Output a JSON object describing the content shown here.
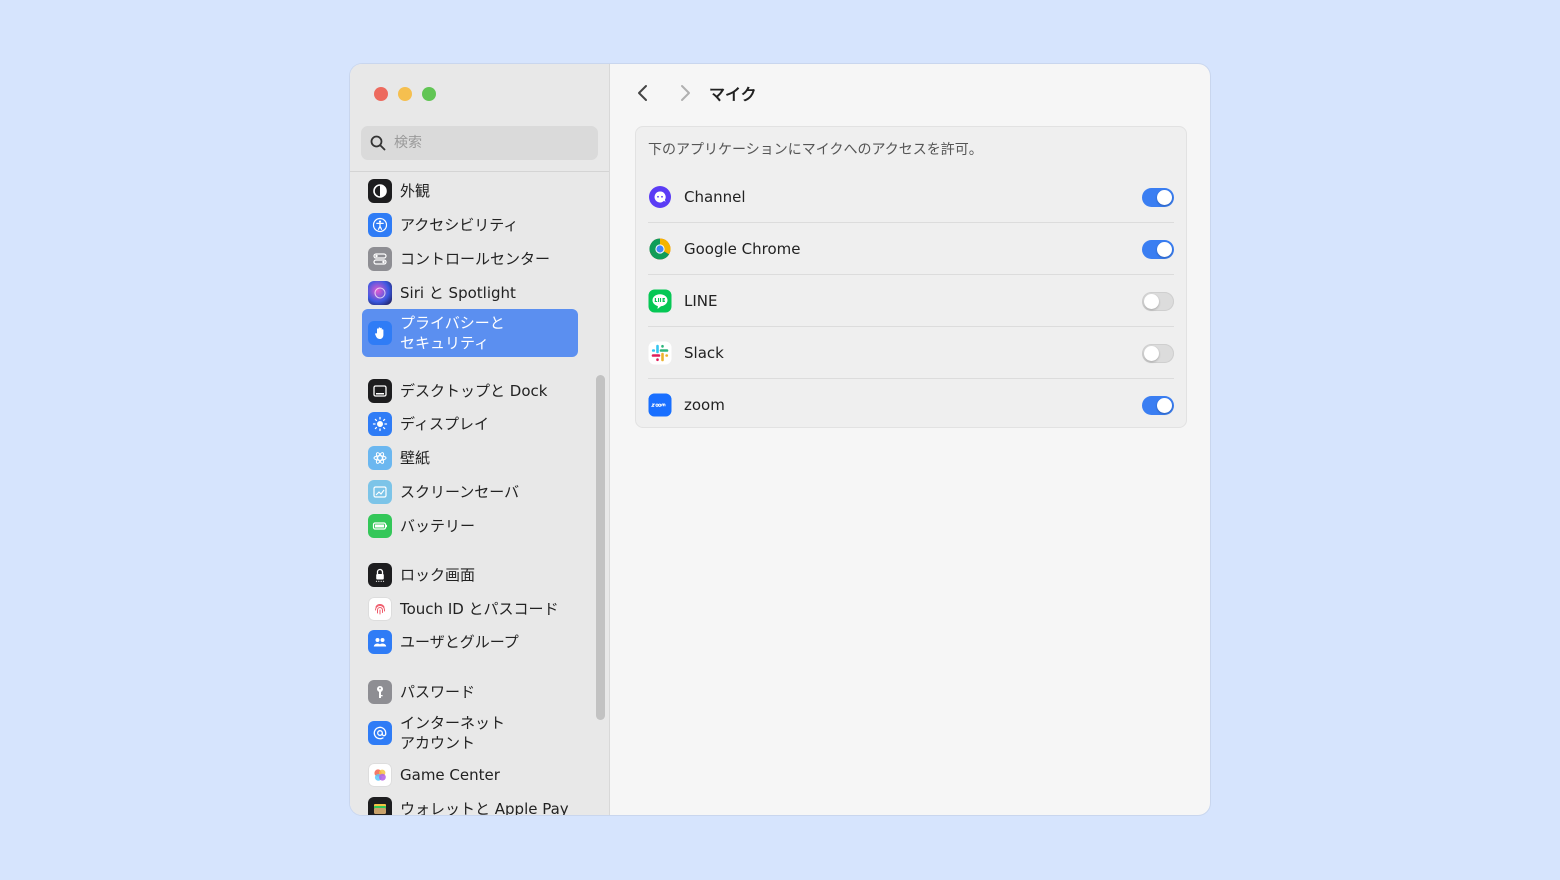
{
  "window": {
    "title": "マイク"
  },
  "search": {
    "placeholder": "検索"
  },
  "sidebar": {
    "items": [
      {
        "label": "外観",
        "icon": "appearance-icon",
        "color": "#1d1d1f"
      },
      {
        "label": "アクセシビリティ",
        "icon": "accessibility-icon",
        "color": "#2f7cf6"
      },
      {
        "label": "コントロールセンター",
        "icon": "control-center-icon",
        "color": "#8e8e93"
      },
      {
        "label": "Siri と Spotlight",
        "icon": "siri-icon",
        "color": "#3b2a6b"
      },
      {
        "label": "プライバシーと\nセキュリティ",
        "icon": "hand-icon",
        "color": "#2f7cf6",
        "active": true
      },
      {
        "label": "デスクトップと Dock",
        "icon": "dock-icon",
        "color": "#1d1d1f"
      },
      {
        "label": "ディスプレイ",
        "icon": "display-icon",
        "color": "#2f7cf6"
      },
      {
        "label": "壁紙",
        "icon": "wallpaper-icon",
        "color": "#6bb7f0"
      },
      {
        "label": "スクリーンセーバ",
        "icon": "screensaver-icon",
        "color": "#7cc4e8"
      },
      {
        "label": "バッテリー",
        "icon": "battery-icon",
        "color": "#34c759"
      },
      {
        "label": "ロック画面",
        "icon": "lock-icon",
        "color": "#1d1d1f"
      },
      {
        "label": "Touch ID とパスコード",
        "icon": "fingerprint-icon",
        "color": "#ffffff"
      },
      {
        "label": "ユーザとグループ",
        "icon": "users-icon",
        "color": "#2f7cf6"
      },
      {
        "label": "パスワード",
        "icon": "key-icon",
        "color": "#8e8e93"
      },
      {
        "label": "インターネット\nアカウント",
        "icon": "at-icon",
        "color": "#2f7cf6"
      },
      {
        "label": "Game Center",
        "icon": "game-center-icon",
        "color": "#ffffff"
      },
      {
        "label": "ウォレットと Apple Pay",
        "icon": "wallet-icon",
        "color": "#1d1d1f"
      }
    ]
  },
  "panel": {
    "description": "下のアプリケーションにマイクへのアクセスを許可。",
    "apps": [
      {
        "name": "Channel",
        "icon": "channel-icon",
        "enabled": true
      },
      {
        "name": "Google Chrome",
        "icon": "chrome-icon",
        "enabled": true
      },
      {
        "name": "LINE",
        "icon": "line-icon",
        "enabled": false
      },
      {
        "name": "Slack",
        "icon": "slack-icon",
        "enabled": false
      },
      {
        "name": "zoom",
        "icon": "zoom-icon",
        "enabled": true
      }
    ]
  },
  "colors": {
    "accent": "#3a7ef2",
    "selection": "#5b8ff0",
    "background": "#d6e4fd"
  }
}
